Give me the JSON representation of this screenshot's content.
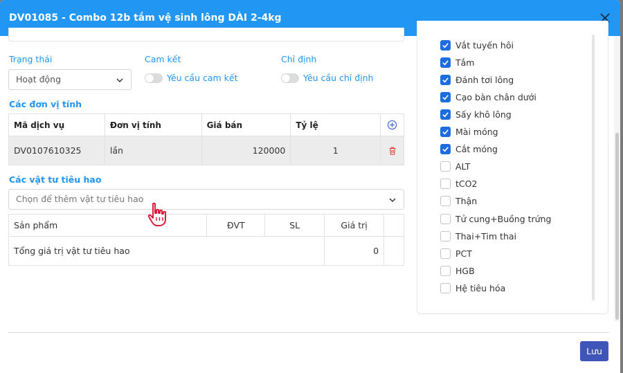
{
  "modal": {
    "title": "DV01085 - Combo 12b tắm vệ sinh lông DÀI 2-4kg",
    "header_color": "#2196f3"
  },
  "status": {
    "label": "Trạng thái",
    "value": "Hoạt động"
  },
  "commitment": {
    "label": "Cam kết",
    "toggle_label": "Yêu cầu cam kết",
    "on": false
  },
  "assignment": {
    "label": "Chỉ định",
    "toggle_label": "Yêu cầu chỉ định",
    "on": false
  },
  "units": {
    "title": "Các đơn vị tính",
    "headers": [
      "Mã dịch vụ",
      "Đơn vị tính",
      "Giá bán",
      "Tỷ lệ"
    ],
    "rows": [
      {
        "code": "DV0107610325",
        "unit": "lần",
        "price": "120000",
        "ratio": "1"
      }
    ]
  },
  "materials": {
    "title": "Các vật tư tiêu hao",
    "placeholder": "Chọn để thêm vật tư tiêu hao",
    "headers": [
      "Sản phẩm",
      "ĐVT",
      "SL",
      "Giá trị"
    ],
    "total_label": "Tổng giá trị vật tư tiêu hao",
    "total_value": "0"
  },
  "checklist": [
    {
      "label": "Vắt tuyến hôi",
      "checked": true
    },
    {
      "label": "Tắm",
      "checked": true
    },
    {
      "label": "Đánh tơi lông",
      "checked": true
    },
    {
      "label": "Cạo bàn chân dưới",
      "checked": true
    },
    {
      "label": "Sấy khô lông",
      "checked": true
    },
    {
      "label": "Mài móng",
      "checked": true
    },
    {
      "label": "Cắt móng",
      "checked": true
    },
    {
      "label": "ALT",
      "checked": false
    },
    {
      "label": "tCO2",
      "checked": false
    },
    {
      "label": "Thận",
      "checked": false
    },
    {
      "label": "Tử cung+Buồng trứng",
      "checked": false
    },
    {
      "label": "Thai+Tim thai",
      "checked": false
    },
    {
      "label": "PCT",
      "checked": false
    },
    {
      "label": "HGB",
      "checked": false
    },
    {
      "label": "Hệ tiêu hóa",
      "checked": false
    }
  ],
  "footer": {
    "save_label": "Lưu"
  },
  "icons": {
    "close": "close-icon",
    "add": "plus-circle-icon",
    "delete": "trash-icon",
    "dropdown": "chevron-down-icon",
    "cursor": "hand-pointer-icon"
  }
}
